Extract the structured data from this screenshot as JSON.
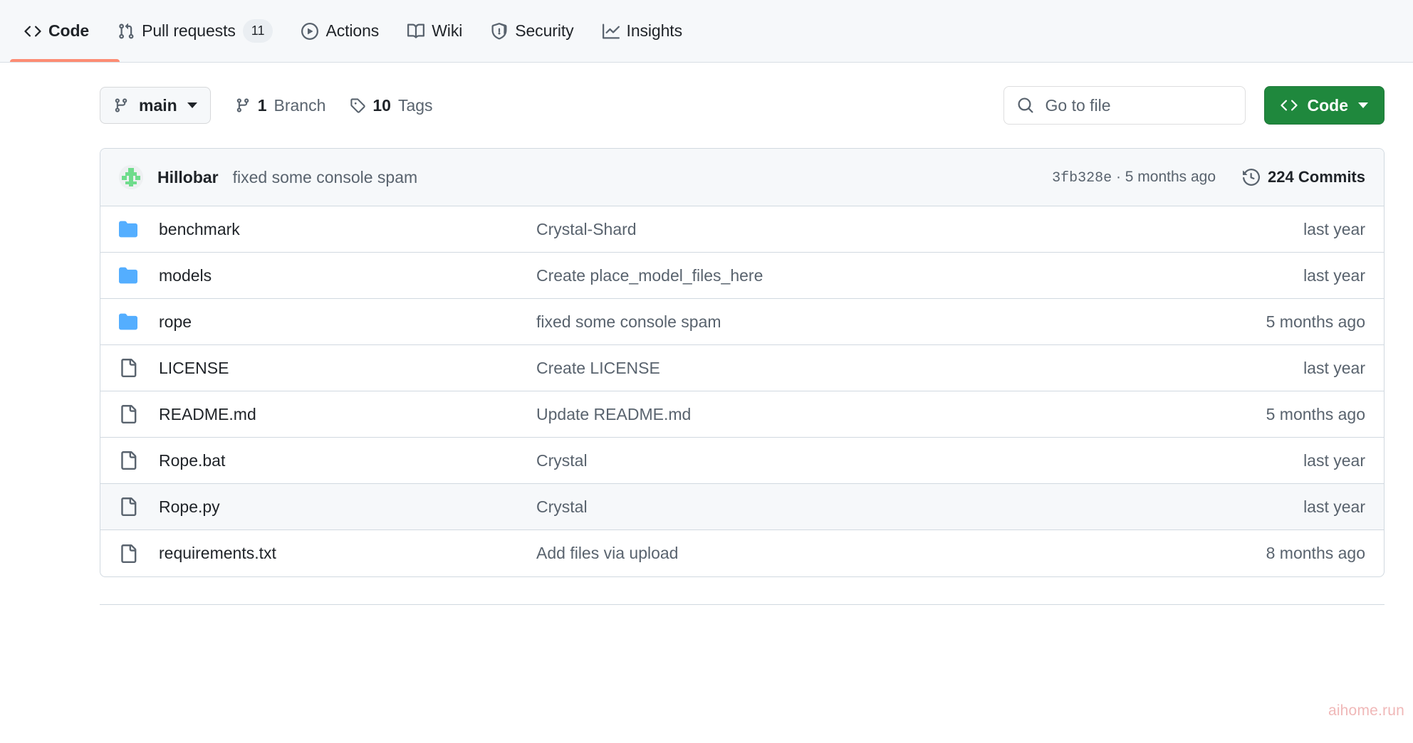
{
  "nav": {
    "items": [
      {
        "label": "Code",
        "icon": "code-icon",
        "active": true,
        "badge": null
      },
      {
        "label": "Pull requests",
        "icon": "git-pull-request-icon",
        "active": false,
        "badge": "11"
      },
      {
        "label": "Actions",
        "icon": "play-circle-icon",
        "active": false,
        "badge": null
      },
      {
        "label": "Wiki",
        "icon": "book-icon",
        "active": false,
        "badge": null
      },
      {
        "label": "Security",
        "icon": "shield-icon",
        "active": false,
        "badge": null
      },
      {
        "label": "Insights",
        "icon": "graph-icon",
        "active": false,
        "badge": null
      }
    ],
    "active_underline_color": "#fd8c73"
  },
  "toolbar": {
    "branch": "main",
    "branches": {
      "count": "1",
      "word": "Branch"
    },
    "tags": {
      "count": "10",
      "word": "Tags"
    },
    "search_placeholder": "Go to file",
    "search_value": "",
    "code_button": "Code",
    "code_button_color": "#1f883d"
  },
  "commit_header": {
    "author": "Hillobar",
    "message": "fixed some console spam",
    "sha": "3fb328e",
    "separator": " · ",
    "relative_time": "5 months ago",
    "commits_label": "224 Commits"
  },
  "files": [
    {
      "name": "benchmark",
      "type": "folder",
      "commit": "Crystal-Shard",
      "time": "last year",
      "hovered": false
    },
    {
      "name": "models",
      "type": "folder",
      "commit": "Create place_model_files_here",
      "time": "last year",
      "hovered": false
    },
    {
      "name": "rope",
      "type": "folder",
      "commit": "fixed some console spam",
      "time": "5 months ago",
      "hovered": false
    },
    {
      "name": "LICENSE",
      "type": "file",
      "commit": "Create LICENSE",
      "time": "last year",
      "hovered": false
    },
    {
      "name": "README.md",
      "type": "file",
      "commit": "Update README.md",
      "time": "5 months ago",
      "hovered": false
    },
    {
      "name": "Rope.bat",
      "type": "file",
      "commit": "Crystal",
      "time": "last year",
      "hovered": false
    },
    {
      "name": "Rope.py",
      "type": "file",
      "commit": "Crystal",
      "time": "last year",
      "hovered": true
    },
    {
      "name": "requirements.txt",
      "type": "file",
      "commit": "Add files via upload",
      "time": "8 months ago",
      "hovered": false
    }
  ],
  "watermark": "aihome.run",
  "colors": {
    "folder_icon": "#54aeff",
    "file_icon": "#59636e",
    "link": "#0969da",
    "muted_text": "#59636e",
    "primary_text": "#1f2328",
    "border": "#d1d9e0",
    "header_bg": "#f6f8fa"
  }
}
